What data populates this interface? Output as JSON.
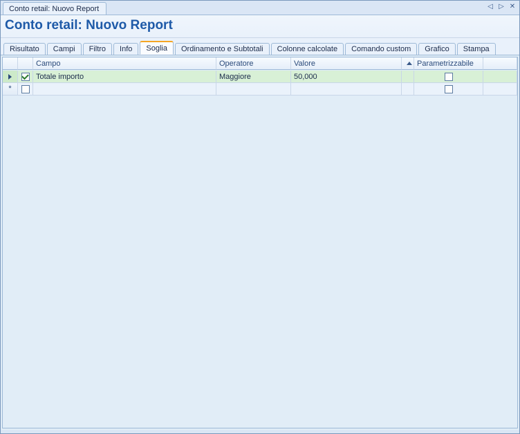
{
  "window": {
    "tab_title": "Conto retail: Nuovo Report"
  },
  "page": {
    "title": "Conto retail: Nuovo Report"
  },
  "tabs": [
    {
      "label": "Risultato",
      "active": false
    },
    {
      "label": "Campi",
      "active": false
    },
    {
      "label": "Filtro",
      "active": false
    },
    {
      "label": "Info",
      "active": false
    },
    {
      "label": "Soglia",
      "active": true
    },
    {
      "label": "Ordinamento e Subtotali",
      "active": false
    },
    {
      "label": "Colonne calcolate",
      "active": false
    },
    {
      "label": "Comando custom",
      "active": false
    },
    {
      "label": "Grafico",
      "active": false
    },
    {
      "label": "Stampa",
      "active": false
    }
  ],
  "grid": {
    "columns": {
      "campo": "Campo",
      "operatore": "Operatore",
      "valore": "Valore",
      "parametrizzabile": "Parametrizzabile"
    },
    "rows": [
      {
        "selected": true,
        "checked": true,
        "campo": "Totale importo",
        "operatore": "Maggiore",
        "valore": "50,000",
        "parametrizzabile": false
      }
    ]
  }
}
